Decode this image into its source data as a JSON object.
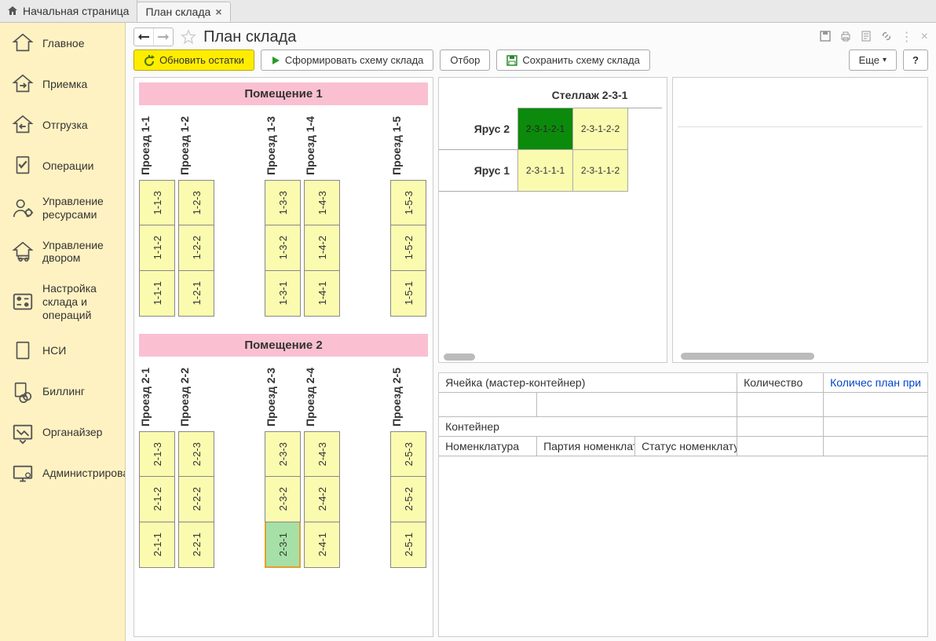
{
  "tabs": {
    "home": "Начальная страница",
    "page": "План склада"
  },
  "sidebar": {
    "items": [
      {
        "label": "Главное",
        "icon": "home"
      },
      {
        "label": "Приемка",
        "icon": "house-in"
      },
      {
        "label": "Отгрузка",
        "icon": "house-out"
      },
      {
        "label": "Операции",
        "icon": "doc-check"
      },
      {
        "label": "Управление ресурсами",
        "icon": "person-gear"
      },
      {
        "label": "Управление двором",
        "icon": "house-truck"
      },
      {
        "label": "Настройка склада и операций",
        "icon": "sliders"
      },
      {
        "label": "НСИ",
        "icon": "doc-currency"
      },
      {
        "label": "Биллинг",
        "icon": "coins"
      },
      {
        "label": "Органайзер",
        "icon": "chart-down"
      },
      {
        "label": "Администрирование",
        "icon": "monitor-gear"
      }
    ]
  },
  "page": {
    "title": "План склада",
    "toolbar": {
      "refresh": "Обновить остатки",
      "generate": "Сформировать схему склада",
      "filter": "Отбор",
      "save": "Сохранить схему склада",
      "more": "Еще",
      "help": "?"
    }
  },
  "plan": {
    "rooms": [
      {
        "title": "Помещение 1",
        "aisles": [
          "Проезд 1-1",
          "Проезд 1-2",
          "",
          "Проезд 1-3",
          "Проезд 1-4",
          "",
          "Проезд 1-5"
        ],
        "rows": [
          [
            "1-1-3",
            "1-2-3",
            "",
            "1-3-3",
            "1-4-3",
            "",
            "1-5-3"
          ],
          [
            "1-1-2",
            "1-2-2",
            "",
            "1-3-2",
            "1-4-2",
            "",
            "1-5-2"
          ],
          [
            "1-1-1",
            "1-2-1",
            "",
            "1-3-1",
            "1-4-1",
            "",
            "1-5-1"
          ]
        ],
        "selected": null
      },
      {
        "title": "Помещение 2",
        "aisles": [
          "Проезд 2-1",
          "Проезд 2-2",
          "",
          "Проезд 2-3",
          "Проезд 2-4",
          "",
          "Проезд 2-5"
        ],
        "rows": [
          [
            "2-1-3",
            "2-2-3",
            "",
            "2-3-3",
            "2-4-3",
            "",
            "2-5-3"
          ],
          [
            "2-1-2",
            "2-2-2",
            "",
            "2-3-2",
            "2-4-2",
            "",
            "2-5-2"
          ],
          [
            "2-1-1",
            "2-2-1",
            "",
            "2-3-1",
            "2-4-1",
            "",
            "2-5-1"
          ]
        ],
        "selected": "2-3-1"
      }
    ]
  },
  "rack": {
    "title": "Стеллаж 2-3-1",
    "tiers": [
      {
        "label": "Ярус 2",
        "cells": [
          {
            "id": "2-3-1-2-1",
            "full": true
          },
          {
            "id": "2-3-1-2-2",
            "full": false
          }
        ]
      },
      {
        "label": "Ярус 1",
        "cells": [
          {
            "id": "2-3-1-1-1",
            "full": false
          },
          {
            "id": "2-3-1-1-2",
            "full": false
          }
        ]
      }
    ]
  },
  "table": {
    "headers": {
      "cell": "Ячейка (мастер-контейнер)",
      "qty": "Количество",
      "qty_plan": "Количес план при",
      "container": "Контейнер",
      "nomen": "Номенклатура",
      "batch": "Партия номенклатуры",
      "status": "Статус номенклатуры"
    }
  }
}
